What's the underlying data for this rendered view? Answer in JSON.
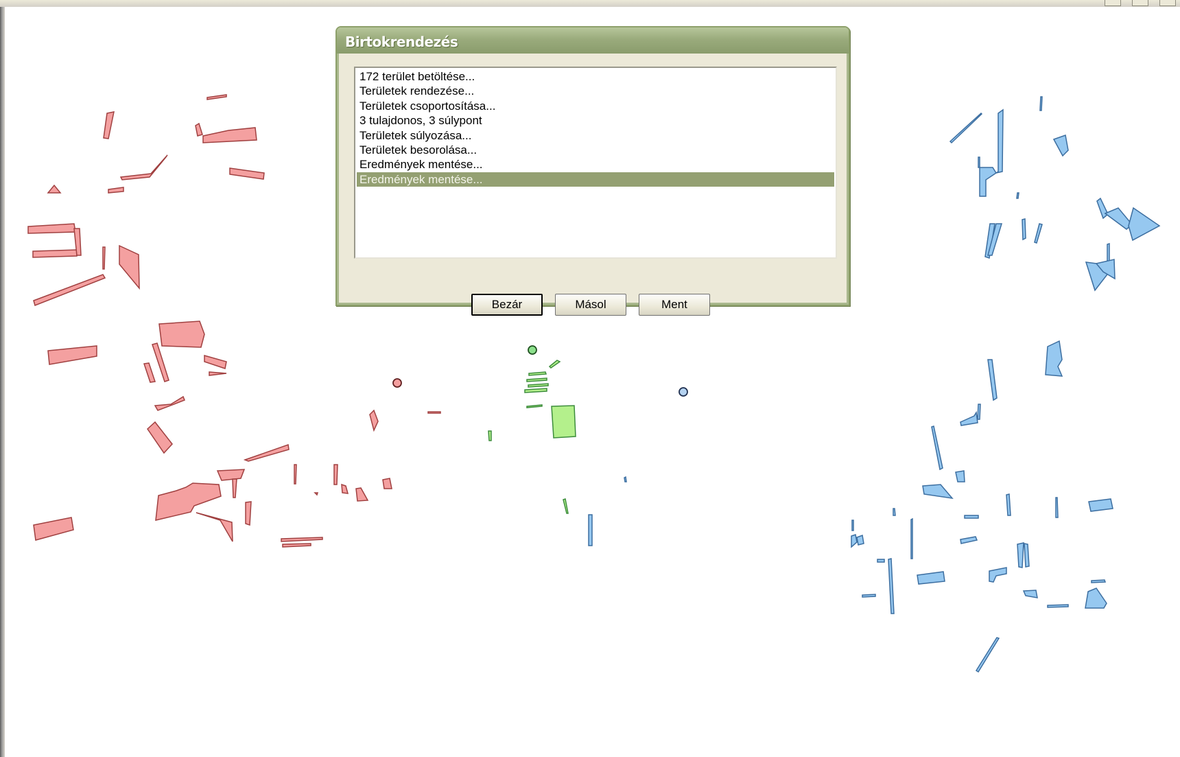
{
  "dialog": {
    "title": "Birtokrendezés",
    "log_items": [
      "172 terület betöltése...",
      "Területek rendezése...",
      "Területek csoportosítása...",
      "3 tulajdonos, 3 súlypont",
      "Területek súlyozása...",
      "Területek besorolása...",
      "Eredmények mentése...",
      "Eredmények mentése..."
    ],
    "selected_index": 7,
    "buttons": {
      "close": "Bezár",
      "copy": "Másol",
      "save": "Ment"
    }
  },
  "map": {
    "owners": [
      {
        "color_fill": "#f4a0a0",
        "color_stroke": "#a04040",
        "centroid_color": "#f4a0a0"
      },
      {
        "color_fill": "#b4f08c",
        "color_stroke": "#3c8c3c",
        "centroid_color": "#8ce08c"
      },
      {
        "color_fill": "#96c8f0",
        "color_stroke": "#3c6ea0",
        "centroid_color": "#b4d2f0"
      }
    ]
  }
}
